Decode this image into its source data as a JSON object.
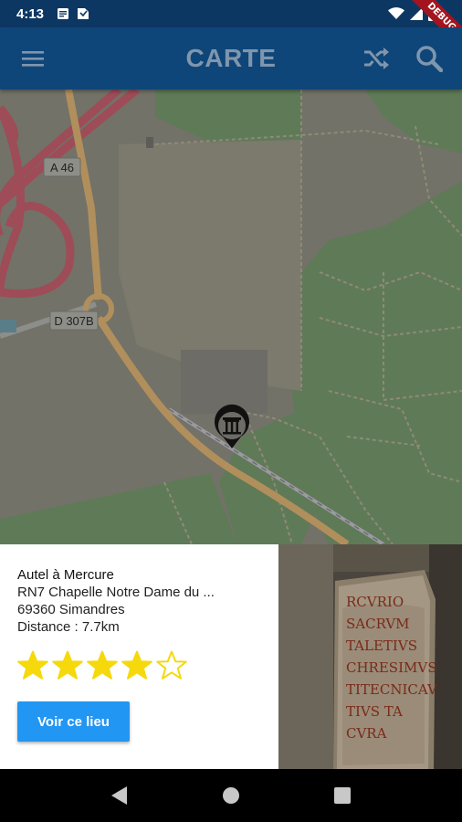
{
  "status_bar": {
    "time": "4:13",
    "debug_label": "DEBUG"
  },
  "app_bar": {
    "title": "CARTE",
    "menu_icon": "menu-icon",
    "shuffle_icon": "shuffle-icon",
    "search_icon": "search-icon"
  },
  "map": {
    "road_labels": [
      "A 46",
      "D 307B"
    ],
    "marker_icon": "temple-pin-icon"
  },
  "place": {
    "name": "Autel à Mercure",
    "address_line1": "RN7 Chapelle Notre Dame du ...",
    "address_line2": "69360 Simandres",
    "distance": "Distance : 7.7km",
    "rating": 4,
    "rating_max": 5,
    "button_label": "Voir ce lieu",
    "photo_inscription": [
      "RCVRIO",
      "SACRVM",
      "TALETIVS",
      "CHRESIMVS",
      "TITECNICAV",
      "TIVS TA",
      "CVRA"
    ]
  },
  "colors": {
    "status_bar": "#0d3763",
    "app_bar": "#0f4679",
    "title": "#7f96ad",
    "button": "#2196f3",
    "star": "#f5d90c"
  }
}
